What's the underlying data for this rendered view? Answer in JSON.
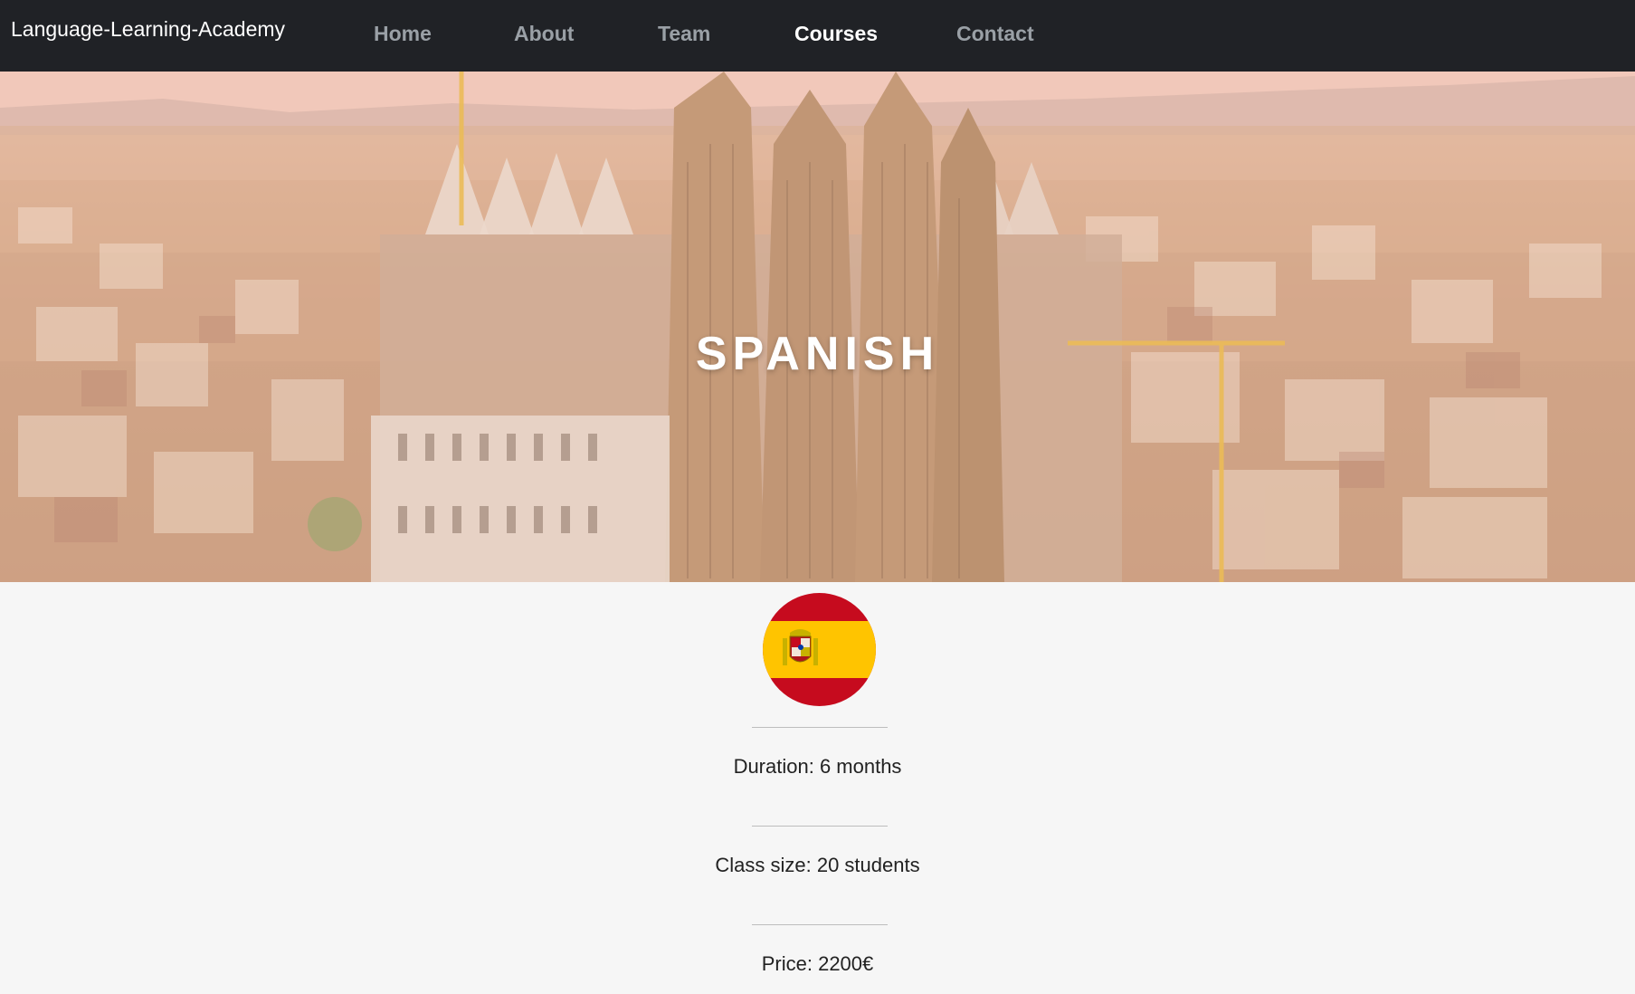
{
  "brand": "Language-Learning-Academy",
  "nav": {
    "home": "Home",
    "about": "About",
    "team": "Team",
    "courses": "Courses",
    "contact": "Contact",
    "active": "Courses"
  },
  "hero": {
    "title": "SPANISH"
  },
  "flag": {
    "icon": "spain-flag-icon",
    "colors": {
      "red": "#c60b1e",
      "yellow": "#ffc400"
    }
  },
  "course": {
    "duration": "Duration: 6 months",
    "class_size": "Class size: 20 students",
    "price": "Price: 2200€"
  },
  "colors": {
    "navbar_bg": "#202226",
    "nav_link": "#9aa0a6",
    "nav_active": "#ffffff",
    "page_bg": "#f6f6f6",
    "text": "#222222"
  }
}
